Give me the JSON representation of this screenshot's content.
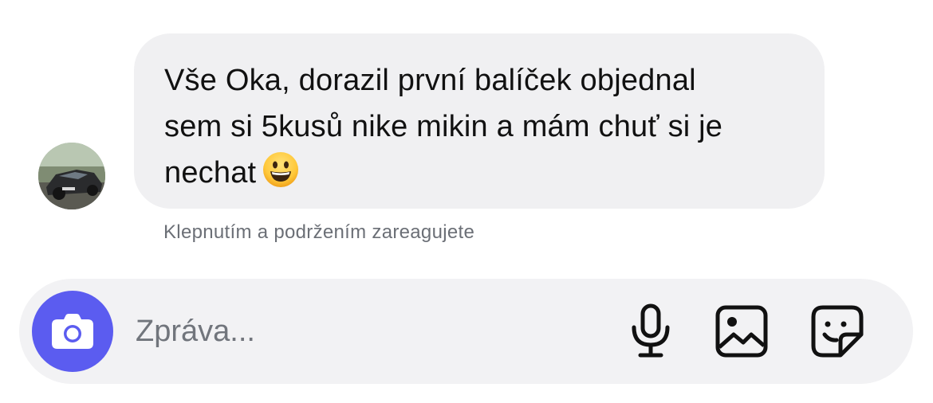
{
  "conversation": {
    "incoming_message": {
      "text": "Vše Oka, dorazil první balíček objednal\nsem si 5kusů nike mikin a mám chuť si je\nnechat",
      "emoji": "grinning-face-emoji"
    },
    "reaction_hint": "Klepnutím a podržením zareagujete",
    "avatar_icon": "profile-photo-car"
  },
  "composer": {
    "placeholder": "Zpráva...",
    "camera_icon": "camera-icon",
    "mic_icon": "microphone-icon",
    "gallery_icon": "image-icon",
    "sticker_icon": "sticker-icon",
    "accent_color": "#5b5cf0"
  }
}
